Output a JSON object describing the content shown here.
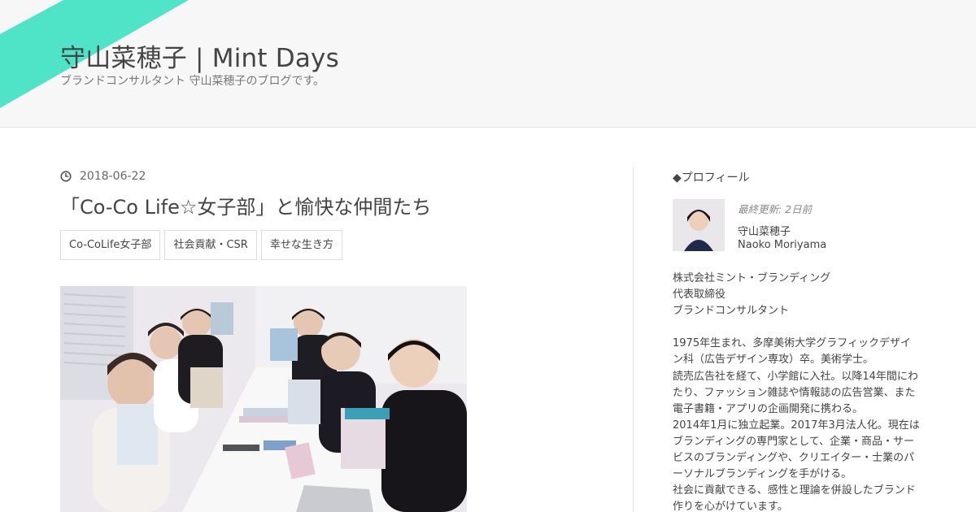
{
  "site": {
    "title": "守山菜穂子 | Mint Days",
    "description": "ブランドコンサルタント 守山菜穂子のブログです。",
    "accent_color": "#4fe3c8"
  },
  "post": {
    "date": "2018-06-22",
    "title": "「Co-Co Life☆女子部」と愉快な仲間たち",
    "tags": [
      "Co-CoLife女子部",
      "社会貢献・CSR",
      "幸せな生き方"
    ],
    "photo_alt": "Co-Co Life☆女子部 group photo"
  },
  "sidebar": {
    "widget_title": "◆プロフィール",
    "updated": "最終更新: 2日前",
    "name_ja": "守山菜穂子",
    "name_en": "Naoko Moriyama",
    "bio_block1": [
      "株式会社ミント・ブランディング",
      "代表取締役",
      "ブランドコンサルタント"
    ],
    "bio_block2": [
      "1975年生まれ、多摩美術大学グラフィックデザイ",
      "ン科（広告デザイン専攻）卒。美術学士。",
      "読売広告社を経て、小学館に入社。以降14年間にわ",
      "たり、ファッション雑誌や情報誌の広告営業、また",
      "電子書籍・アプリの企画開発に携わる。",
      "2014年1月に独立起業。2017年3月法人化。現在は",
      "ブランディングの専門家として、企業・商品・サー",
      "ビスのブランディングや、クリエイター・士業のパ",
      "ーソナルブランディングを手がける。",
      "社会に貢献できる、感性と理論を併設したブランド",
      "作りを心がけています。"
    ]
  }
}
